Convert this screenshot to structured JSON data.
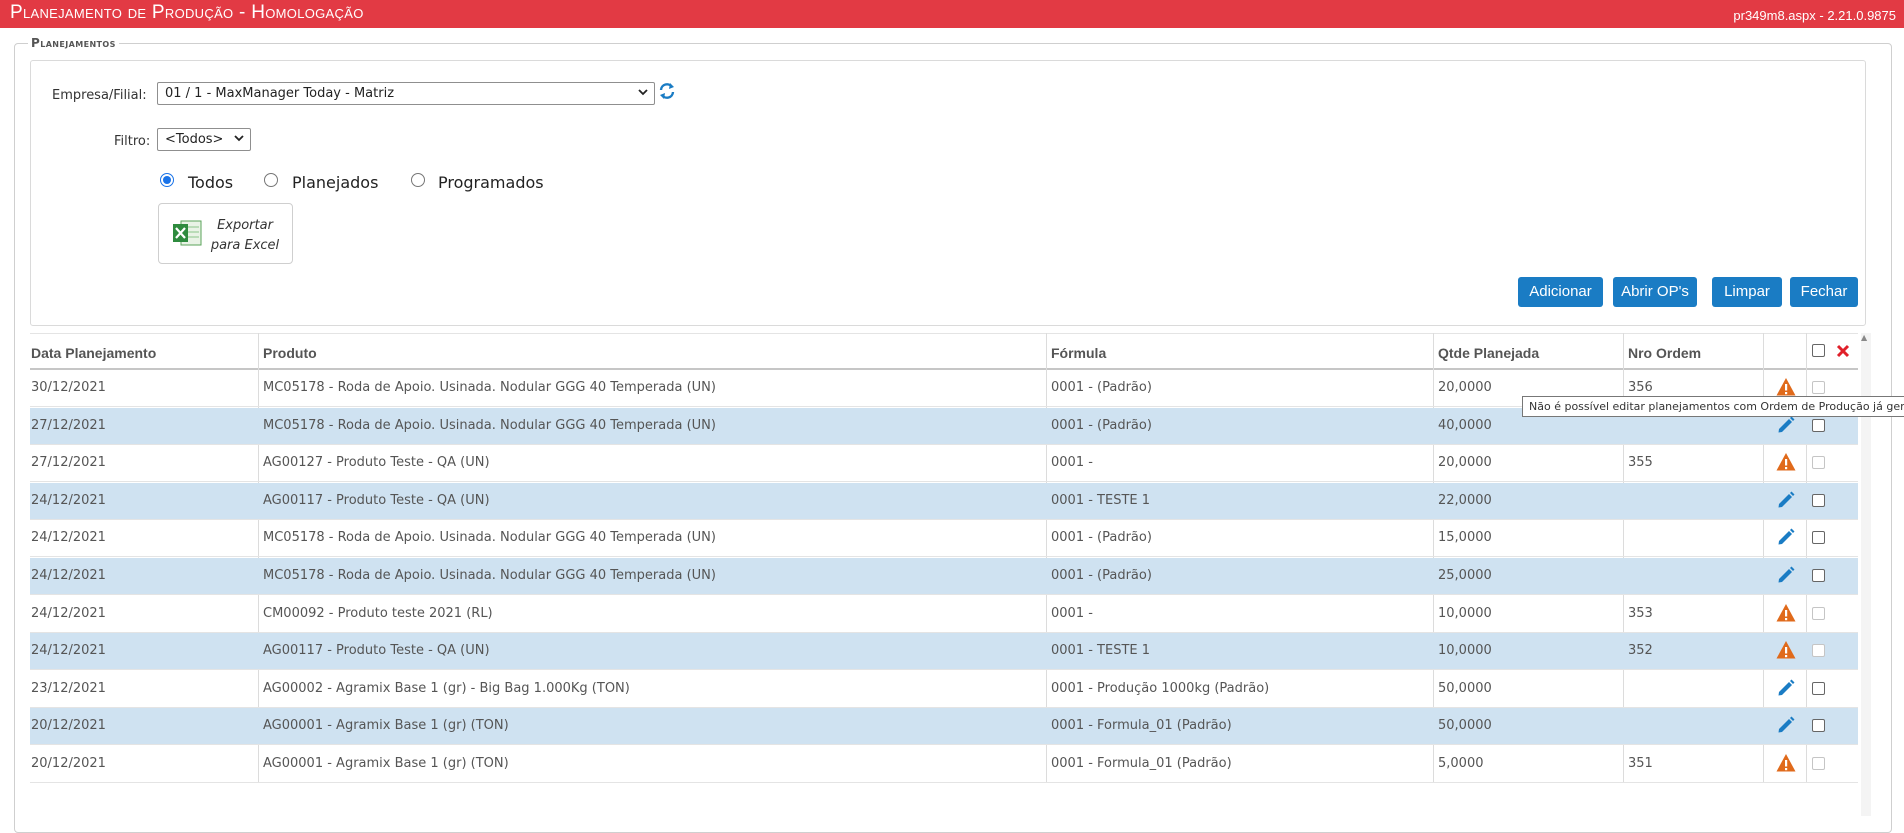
{
  "header": {
    "title": "Planejamento de Produção  - Homologação",
    "version": "pr349m8.aspx - 2.21.0.9875"
  },
  "section": {
    "legend": "Planejamentos"
  },
  "filters": {
    "empresa_label": "Empresa/Filial:",
    "empresa_value": "01 / 1 - MaxManager Today - Matriz",
    "filtro_label": "Filtro:",
    "filtro_value": "<Todos>",
    "radios": [
      {
        "label": "Todos",
        "selected": true
      },
      {
        "label": "Planejados",
        "selected": false
      },
      {
        "label": "Programados",
        "selected": false
      }
    ],
    "export_label_1": "Exportar",
    "export_label_2": "para Excel"
  },
  "buttons": {
    "adicionar": "Adicionar",
    "abrir_ops": "Abrir OP's",
    "limpar": "Limpar",
    "fechar": "Fechar"
  },
  "table": {
    "columns": [
      "Data Planejamento",
      "Produto",
      "Fórmula",
      "Qtde Planejada",
      "Nro Ordem"
    ],
    "rows": [
      {
        "data": "30/12/2021",
        "produto": "MC05178 - Roda de Apoio. Usinada. Nodular GGG 40 Temperada (UN)",
        "formula": "0001 - (Padrão)",
        "qtde": "20,0000",
        "ordem": "356",
        "action": "warning-icon",
        "checkbox_enabled": false
      },
      {
        "data": "27/12/2021",
        "produto": "MC05178 - Roda de Apoio. Usinada. Nodular GGG 40 Temperada (UN)",
        "formula": "0001 - (Padrão)",
        "qtde": "40,0000",
        "ordem": "",
        "action": "edit-icon",
        "checkbox_enabled": true
      },
      {
        "data": "27/12/2021",
        "produto": "AG00127 - Produto Teste - QA (UN)",
        "formula": "0001 -",
        "qtde": "20,0000",
        "ordem": "355",
        "action": "warning-icon",
        "checkbox_enabled": false
      },
      {
        "data": "24/12/2021",
        "produto": "AG00117 - Produto Teste - QA (UN)",
        "formula": "0001 - TESTE 1",
        "qtde": "22,0000",
        "ordem": "",
        "action": "edit-icon",
        "checkbox_enabled": true
      },
      {
        "data": "24/12/2021",
        "produto": "MC05178 - Roda de Apoio. Usinada. Nodular GGG 40 Temperada (UN)",
        "formula": "0001 - (Padrão)",
        "qtde": "15,0000",
        "ordem": "",
        "action": "edit-icon",
        "checkbox_enabled": true
      },
      {
        "data": "24/12/2021",
        "produto": "MC05178 - Roda de Apoio. Usinada. Nodular GGG 40 Temperada (UN)",
        "formula": "0001 - (Padrão)",
        "qtde": "25,0000",
        "ordem": "",
        "action": "edit-icon",
        "checkbox_enabled": true
      },
      {
        "data": "24/12/2021",
        "produto": "CM00092 - Produto teste 2021 (RL)",
        "formula": "0001 -",
        "qtde": "10,0000",
        "ordem": "353",
        "action": "warning-icon",
        "checkbox_enabled": false
      },
      {
        "data": "24/12/2021",
        "produto": "AG00117 - Produto Teste - QA (UN)",
        "formula": "0001 - TESTE 1",
        "qtde": "10,0000",
        "ordem": "352",
        "action": "warning-icon",
        "checkbox_enabled": false
      },
      {
        "data": "23/12/2021",
        "produto": "AG00002 - Agramix Base 1 (gr) - Big Bag 1.000Kg (TON)",
        "formula": "0001 - Produção 1000kg (Padrão)",
        "qtde": "50,0000",
        "ordem": "",
        "action": "edit-icon",
        "checkbox_enabled": true
      },
      {
        "data": "20/12/2021",
        "produto": "AG00001 - Agramix Base 1 (gr) (TON)",
        "formula": "0001 - Formula_01 (Padrão)",
        "qtde": "50,0000",
        "ordem": "",
        "action": "edit-icon",
        "checkbox_enabled": true
      },
      {
        "data": "20/12/2021",
        "produto": "AG00001 - Agramix Base 1 (gr) (TON)",
        "formula": "0001 - Formula_01 (Padrão)",
        "qtde": "5,0000",
        "ordem": "351",
        "action": "warning-icon",
        "checkbox_enabled": false
      }
    ]
  },
  "tooltip": "Não é possível editar planejamentos com Ordem de Produção já gerada",
  "colors": {
    "header_bg": "#e23a44",
    "button_bg": "#1a7cc4",
    "row_alt": "#cfe2f1",
    "warning": "#e06a1b",
    "edit": "#1a7cc4",
    "delete": "#e0202a"
  }
}
